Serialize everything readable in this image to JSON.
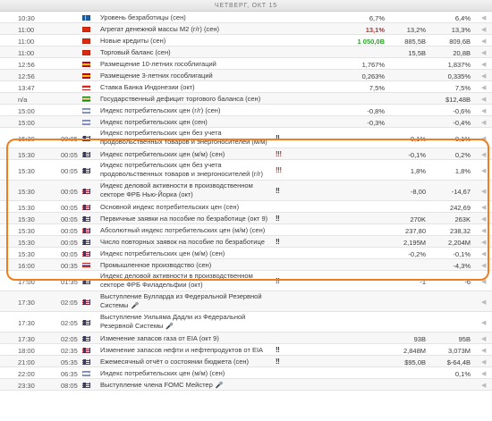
{
  "header": {
    "title": "ЧЕТВЕРГ, ОКТ 15"
  },
  "colors": {
    "highlight": "#f07e1e",
    "high": "#d7261e",
    "medium": "#e09a1b",
    "low": "#c8b35a",
    "up": "#27a327",
    "down": "#d7261e"
  },
  "rows": [
    {
      "time": "10:30",
      "left": "",
      "flag": "se",
      "name": "Уровень безработицы (сен)",
      "impact": "low",
      "imp": "",
      "actual": "6,7%",
      "actual_color": "",
      "forecast": "",
      "previous": "6,4%"
    },
    {
      "time": "11:00",
      "left": "",
      "flag": "cn",
      "name": "Агрегат денежной массы М2 (г/г) (сен)",
      "impact": "low",
      "imp": "",
      "actual": "13,1%",
      "actual_color": "down",
      "forecast": "13,2%",
      "previous": "13,3%"
    },
    {
      "time": "11:00",
      "left": "",
      "flag": "cn",
      "name": "Новые кредиты (сен)",
      "impact": "low",
      "imp": "",
      "actual": "1 050,0B",
      "actual_color": "up",
      "forecast": "885,5B",
      "previous": "809,6B"
    },
    {
      "time": "11:00",
      "left": "",
      "flag": "cn",
      "name": "Торговый баланс (сен)",
      "impact": "low",
      "imp": "",
      "actual": "",
      "actual_color": "",
      "forecast": "15,5B",
      "previous": "20,8B"
    },
    {
      "time": "12:56",
      "left": "",
      "flag": "es",
      "name": "Размещение 10-летних гособлигаций",
      "impact": "low",
      "imp": "",
      "actual": "1,767%",
      "actual_color": "",
      "forecast": "",
      "previous": "1,837%"
    },
    {
      "time": "12:56",
      "left": "",
      "flag": "es",
      "name": "Размещение 3-летних гособлигаций",
      "impact": "low",
      "imp": "",
      "actual": "0,263%",
      "actual_color": "",
      "forecast": "",
      "previous": "0,335%"
    },
    {
      "time": "13:47",
      "left": "",
      "flag": "id",
      "name": "Ставка Банка Индонезии (окт)",
      "impact": "low",
      "imp": "",
      "actual": "7,5%",
      "actual_color": "",
      "forecast": "",
      "previous": "7,5%"
    },
    {
      "time": "n/a",
      "left": "",
      "flag": "in",
      "name": "Государственный дефицит торгового баланса (сен)",
      "impact": "low",
      "imp": "",
      "actual": "",
      "actual_color": "",
      "forecast": "",
      "previous": "$12,48B"
    },
    {
      "time": "15:00",
      "left": "",
      "flag": "il",
      "name": "Индекс потребительских цен (г/г) (сен)",
      "impact": "low",
      "imp": "",
      "actual": "-0,8%",
      "actual_color": "",
      "forecast": "",
      "previous": "-0,6%"
    },
    {
      "time": "15:00",
      "left": "",
      "flag": "il",
      "name": "Индекс потребительских цен (сен)",
      "impact": "low",
      "imp": "",
      "actual": "-0,3%",
      "actual_color": "",
      "forecast": "",
      "previous": "-0,4%"
    },
    {
      "time": "15:30",
      "left": "00:05",
      "flag": "us",
      "name": "Индекс потребительских цен без учета продовольственных товаров и энергоносителей (м/м) (сен)",
      "impact": "medium",
      "imp": "!!",
      "actual": "",
      "actual_color": "",
      "forecast": "0,1%",
      "previous": "0,1%"
    },
    {
      "time": "15:30",
      "left": "00:05",
      "flag": "us",
      "name": "Индекс потребительских цен (м/м) (сен)",
      "impact": "high",
      "imp": "!!!",
      "actual": "",
      "actual_color": "",
      "forecast": "-0,1%",
      "previous": "0,2%"
    },
    {
      "time": "15:30",
      "left": "00:05",
      "flag": "us",
      "name": "Индекс потребительских цен без учета продовольственных товаров и энергоносителей (г/г) (сен)",
      "impact": "high",
      "imp": "!!!",
      "actual": "",
      "actual_color": "",
      "forecast": "1,8%",
      "previous": "1,8%"
    },
    {
      "time": "15:30",
      "left": "00:05",
      "flag": "us",
      "name": "Индекс деловой активности в производственном секторе ФРБ Нью-Йорка (окт)",
      "impact": "medium",
      "imp": "!!",
      "actual": "",
      "actual_color": "",
      "forecast": "-8,00",
      "previous": "-14,67"
    },
    {
      "time": "15:30",
      "left": "00:05",
      "flag": "us",
      "name": "Основной индекс потребительских цен (сен)",
      "impact": "low",
      "imp": "",
      "actual": "",
      "actual_color": "",
      "forecast": "",
      "previous": "242,69"
    },
    {
      "time": "15:30",
      "left": "00:05",
      "flag": "us",
      "name": "Первичные заявки на пособие по безработице (окт 9)",
      "impact": "medium",
      "imp": "!!",
      "actual": "",
      "actual_color": "",
      "forecast": "270K",
      "previous": "263K"
    },
    {
      "time": "15:30",
      "left": "00:05",
      "flag": "us",
      "name": "Абсолютный индекс потребительских цен (м/м) (сен)",
      "impact": "low",
      "imp": "",
      "actual": "",
      "actual_color": "",
      "forecast": "237,80",
      "previous": "238,32"
    },
    {
      "time": "15:30",
      "left": "00:05",
      "flag": "us",
      "name": "Число повторных заявок на пособие по безработице (окт 2)",
      "impact": "medium",
      "imp": "!!",
      "actual": "",
      "actual_color": "",
      "forecast": "2,195M",
      "previous": "2,204M"
    },
    {
      "time": "15:30",
      "left": "00:05",
      "flag": "us",
      "name": "Индекс потребительских цен (м/м) (сен)",
      "impact": "low",
      "imp": "",
      "actual": "",
      "actual_color": "",
      "forecast": "-0,2%",
      "previous": "-0,1%"
    },
    {
      "time": "16:00",
      "left": "00:35",
      "flag": "ru",
      "name": "Промышленное производство (сен)",
      "impact": "low",
      "imp": "",
      "actual": "",
      "actual_color": "",
      "forecast": "",
      "previous": "-4,3%"
    },
    {
      "time": "17:00",
      "left": "01:35",
      "flag": "us",
      "name": "Индекс деловой активности в производственном секторе ФРБ Филадельфии (окт)",
      "impact": "medium",
      "imp": "!!",
      "actual": "",
      "actual_color": "",
      "forecast": "-1",
      "previous": "-6"
    },
    {
      "time": "17:30",
      "left": "02:05",
      "flag": "us",
      "name": "Выступление Булларда из Федеральной Резервной Системы",
      "impact": "low",
      "imp": "",
      "actual": "",
      "actual_color": "",
      "forecast": "",
      "previous": "",
      "mic": true
    },
    {
      "time": "17:30",
      "left": "02:05",
      "flag": "us",
      "name": "Выступление Уильяма Дадли из Федеральной Резервной Системы",
      "impact": "low",
      "imp": "",
      "actual": "",
      "actual_color": "",
      "forecast": "",
      "previous": "",
      "mic": true
    },
    {
      "time": "17:30",
      "left": "02:05",
      "flag": "us",
      "name": "Изменение запасов газа от EIA (окт 9)",
      "impact": "low",
      "imp": "",
      "actual": "",
      "actual_color": "",
      "forecast": "93B",
      "previous": "95B"
    },
    {
      "time": "18:00",
      "left": "02:35",
      "flag": "us",
      "name": "Изменение запасов нефти и нефтепродуктов от EIA (окт 9)",
      "impact": "medium",
      "imp": "!!",
      "actual": "",
      "actual_color": "",
      "forecast": "2,848M",
      "previous": "3,073M"
    },
    {
      "time": "21:00",
      "left": "05:35",
      "flag": "us",
      "name": "Ежемесячный отчёт о состоянии бюджета (сен)",
      "impact": "medium",
      "imp": "!!",
      "actual": "",
      "actual_color": "",
      "forecast": "$95,0B",
      "previous": "$-64,4B"
    },
    {
      "time": "22:00",
      "left": "06:35",
      "flag": "il",
      "name": "Индекс потребительских цен (м/м) (сен)",
      "impact": "low",
      "imp": "",
      "actual": "",
      "actual_color": "",
      "forecast": "",
      "previous": "0,1%"
    },
    {
      "time": "23:30",
      "left": "08:05",
      "flag": "us",
      "name": "Выступление члена FOMC Мейстер",
      "impact": "low",
      "imp": "",
      "actual": "",
      "actual_color": "",
      "forecast": "",
      "previous": "",
      "mic": true
    }
  ]
}
